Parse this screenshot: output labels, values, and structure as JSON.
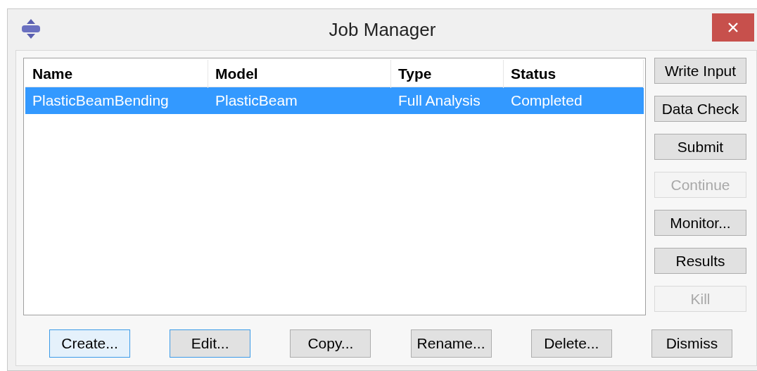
{
  "window": {
    "title": "Job Manager"
  },
  "table": {
    "columns": [
      "Name",
      "Model",
      "Type",
      "Status"
    ],
    "rows": [
      {
        "cells": [
          "PlasticBeamBending",
          "PlasticBeam",
          "Full Analysis",
          "Completed"
        ],
        "selected": true
      }
    ]
  },
  "side_buttons": [
    {
      "label": "Write Input",
      "disabled": false
    },
    {
      "label": "Data Check",
      "disabled": false
    },
    {
      "label": "Submit",
      "disabled": false
    },
    {
      "label": "Continue",
      "disabled": true
    },
    {
      "label": "Monitor...",
      "disabled": false
    },
    {
      "label": "Results",
      "disabled": false
    },
    {
      "label": "Kill",
      "disabled": true
    }
  ],
  "bottom_buttons": [
    {
      "label": "Create...",
      "highlighted": true,
      "default": false
    },
    {
      "label": "Edit...",
      "highlighted": false,
      "default": true
    },
    {
      "label": "Copy...",
      "highlighted": false,
      "default": false
    },
    {
      "label": "Rename...",
      "highlighted": false,
      "default": false
    },
    {
      "label": "Delete...",
      "highlighted": false,
      "default": false
    },
    {
      "label": "Dismiss",
      "highlighted": false,
      "default": false
    }
  ]
}
